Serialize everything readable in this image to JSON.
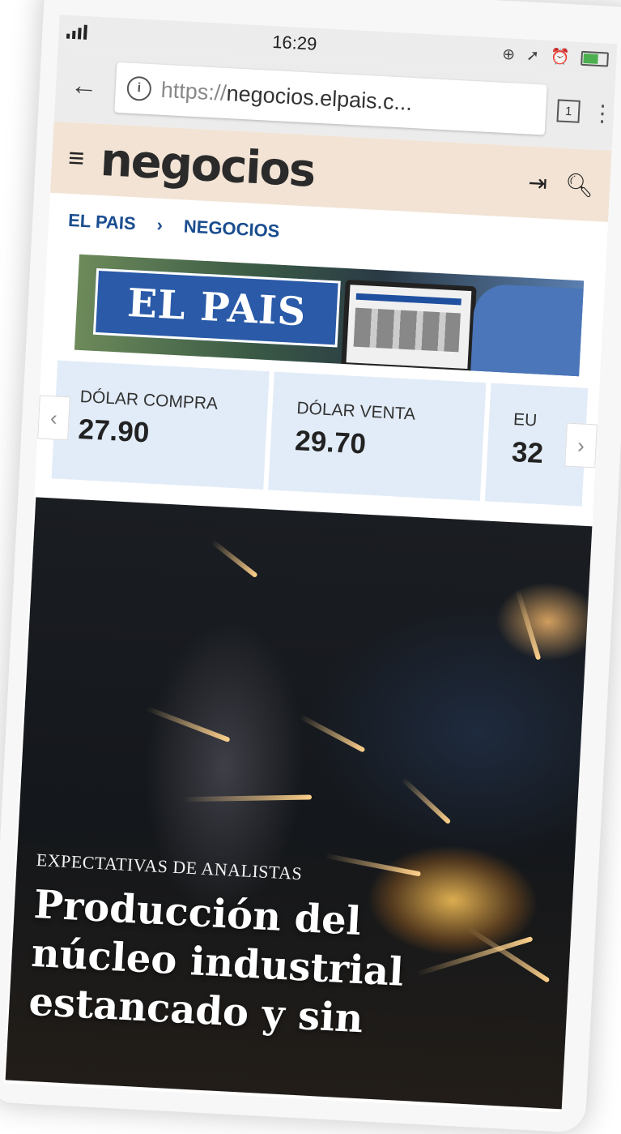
{
  "status_bar": {
    "time": "16:29"
  },
  "browser": {
    "url_scheme": "https://",
    "url_rest": "negocios.elpais.c...",
    "tab_count": "1"
  },
  "site": {
    "logo": "negocios"
  },
  "breadcrumb": {
    "items": [
      "EL PAIS",
      "NEGOCIOS"
    ]
  },
  "banner": {
    "logo_text": "EL PAIS"
  },
  "rates": {
    "items": [
      {
        "label": "DÓLAR COMPRA",
        "value": "27.90"
      },
      {
        "label": "DÓLAR VENTA",
        "value": "29.70"
      },
      {
        "label": "EU",
        "value": "32"
      }
    ]
  },
  "hero": {
    "kicker": "EXPECTATIVAS DE ANALISTAS",
    "title": "Producción del núcleo industrial estancado y sin"
  }
}
